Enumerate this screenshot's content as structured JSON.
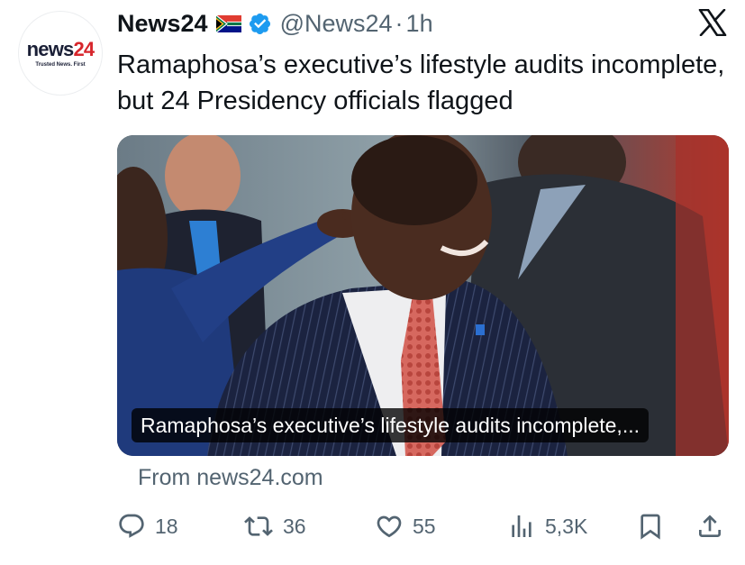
{
  "account": {
    "display_name": "News24",
    "handle": "@News24",
    "separator": "·",
    "timestamp": "1h",
    "flag_icon": "south-africa-flag-icon",
    "verified_icon": "verified-badge-icon",
    "avatar": {
      "logo_news": "news",
      "logo_24": "24",
      "tagline": "Trusted News. First"
    }
  },
  "platform_logo": "x-logo-icon",
  "tweet": {
    "text": "Ramaphosa’s executive’s lifestyle audits incomplete, but 24 Presidency officials flagged"
  },
  "card": {
    "image": "photo of Ramaphosa in pinstripe suit and pink tie, smiling, a man pointing in foreground",
    "caption": "Ramaphosa’s executive’s lifestyle audits incomplete,...",
    "source": "From news24.com"
  },
  "actions": {
    "reply": {
      "icon": "reply-icon",
      "count": "18"
    },
    "retweet": {
      "icon": "retweet-icon",
      "count": "36"
    },
    "like": {
      "icon": "heart-icon",
      "count": "55"
    },
    "views": {
      "icon": "views-chart-icon",
      "count": "5,3K"
    },
    "bookmark": {
      "icon": "bookmark-icon"
    },
    "share": {
      "icon": "share-icon"
    }
  },
  "colors": {
    "text": "#0f1419",
    "secondary": "#536471",
    "verified": "#1d9bf0",
    "brand_red": "#d7262c"
  }
}
